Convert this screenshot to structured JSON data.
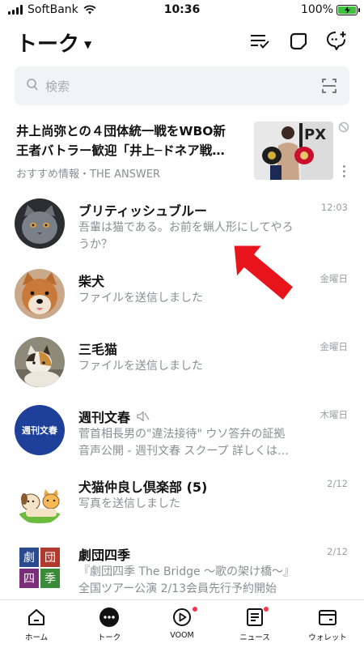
{
  "status_bar": {
    "carrier": "SoftBank",
    "time": "10:36",
    "battery": "100%"
  },
  "header": {
    "title": "トーク",
    "icons": [
      "sort-icon",
      "edit-icon",
      "add-chat-icon"
    ]
  },
  "search": {
    "placeholder": "検索"
  },
  "ad": {
    "headline_line1": "井上尚弥との４団体統一戦をWBO新",
    "headline_line2": "王者バトラー歓迎「井上─ドネア戦…",
    "source": "おすすめ情報・THE ANSWER"
  },
  "chats": [
    {
      "name": "ブリティッシュブルー",
      "preview_line1": "吾輩は猫である。お前を蝋人形にしてやろ",
      "preview_line2": "うか？",
      "time": "12:03",
      "muted": false
    },
    {
      "name": "柴犬",
      "preview_line1": "ファイルを送信しました",
      "preview_line2": "",
      "time": "金曜日",
      "muted": false
    },
    {
      "name": "三毛猫",
      "preview_line1": "ファイルを送信しました",
      "preview_line2": "",
      "time": "金曜日",
      "muted": false
    },
    {
      "name": "週刊文春",
      "preview_line1": "菅首相長男の\"違法接待\" ウソ答弁の証拠",
      "preview_line2": "音声公開 - 週刊文春 スクープ 詳しくは…",
      "time": "木曜日",
      "muted": true,
      "avatar_text": "週刊文春"
    },
    {
      "name": "犬猫仲良し倶楽部 (5)",
      "preview_line1": "写真を送信しました",
      "preview_line2": "",
      "time": "2/12",
      "muted": false
    },
    {
      "name": "劇団四季",
      "preview_line1": "『劇団四季 The Bridge ～歌の架け橋～』",
      "preview_line2": "全国ツアー公演 2/13会員先行予約開始",
      "time": "2/12",
      "muted": false,
      "avatar_chars": [
        "劇",
        "団",
        "四",
        "季"
      ]
    }
  ],
  "nav": [
    {
      "label": "ホーム",
      "icon": "home-icon",
      "badge": false,
      "active": false
    },
    {
      "label": "トーク",
      "icon": "talk-icon",
      "badge": false,
      "active": true
    },
    {
      "label": "VOOM",
      "icon": "voom-icon",
      "badge": true,
      "active": false
    },
    {
      "label": "ニュース",
      "icon": "news-icon",
      "badge": true,
      "active": false
    },
    {
      "label": "ウォレット",
      "icon": "wallet-icon",
      "badge": false,
      "active": false
    }
  ],
  "colors": {
    "arrow": "#e8141b",
    "badge": "#ff334b",
    "battery": "#3ec23e",
    "search_bg": "#f2f3f5"
  }
}
